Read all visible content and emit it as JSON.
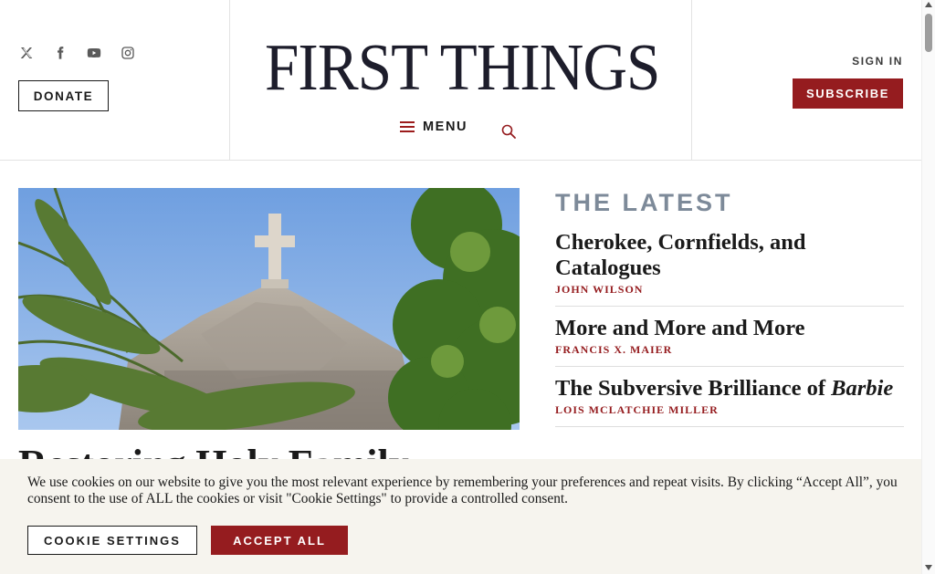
{
  "header": {
    "logo_text": "FIRST THINGS",
    "social_icons": [
      "x-twitter-icon",
      "facebook-icon",
      "youtube-icon",
      "instagram-icon"
    ],
    "donate_label": "DONATE",
    "menu_label": "MENU",
    "signin_label": "SIGN IN",
    "subscribe_label": "SUBSCRIBE"
  },
  "hero": {
    "title": "Restoring Holy Family"
  },
  "latest": {
    "heading": "THE LATEST",
    "articles": [
      {
        "title": "Cherokee, Cornfields, and Catalogues",
        "author": "JOHN WILSON"
      },
      {
        "title": "More and More and More",
        "author": "FRANCIS X. MAIER"
      },
      {
        "title_prefix": "The Subversive Brilliance of ",
        "title_em": "Barbie",
        "author": "LOIS MCLATCHIE MILLER"
      }
    ]
  },
  "cookie": {
    "text": "We use cookies on our website to give you the most relevant experience by remembering your preferences and repeat visits. By clicking “Accept All”, you consent to the use of ALL the cookies or visit \"Cookie Settings\" to provide a controlled consent.",
    "settings_label": "COOKIE SETTINGS",
    "accept_label": "ACCEPT ALL"
  },
  "colors": {
    "brand_red": "#951c1f",
    "latest_heading": "#7d8a99",
    "cookie_bg": "#f6f4ee"
  }
}
